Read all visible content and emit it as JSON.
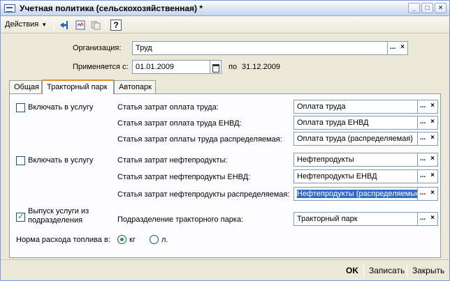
{
  "window": {
    "title": "Учетная политика (сельскохозяйственная) *",
    "minimize": "_",
    "maximize": "□",
    "close": "×"
  },
  "toolbar": {
    "actions_label": "Действия",
    "icons": [
      "back-arrow-icon",
      "structure-icon",
      "copy-icon",
      "help-icon"
    ],
    "help_glyph": "?"
  },
  "header": {
    "organization_label": "Организация:",
    "organization_value": "Труд",
    "applies_label": "Применяется с:",
    "applies_from": "01.01.2009",
    "to_label": "по",
    "applies_to": "31.12.2009",
    "select_glyph": "...",
    "clear_glyph": "×"
  },
  "tabs": [
    {
      "label": "Общая",
      "active": false
    },
    {
      "label": "Тракторный парк",
      "active": true
    },
    {
      "label": "Автопарк",
      "active": false
    }
  ],
  "panel": {
    "group1": {
      "checkbox_label": "Включать в услугу",
      "checked": false,
      "rows": [
        {
          "label": "Статья затрат оплата труда:",
          "value": "Оплата труда"
        },
        {
          "label": "Статья затрат оплата труда ЕНВД:",
          "value": "Оплата труда ЕНВД"
        },
        {
          "label": "Статья затрат оплаты труда распределяемая:",
          "value": "Оплата труда (распределяемая)"
        }
      ]
    },
    "group2": {
      "checkbox_label": "Включать в услугу",
      "checked": false,
      "rows": [
        {
          "label": "Статья затрат нефтепродукты:",
          "value": "Нефтепродукты"
        },
        {
          "label": "Статья затрат нефтепродукты ЕНВД:",
          "value": "Нефтепродукты ЕНВД"
        },
        {
          "label": "Статья затрат нефтепродукты распределяемая:",
          "value": "Нефтепродукты (распределяемые"
        }
      ]
    },
    "group3": {
      "checkbox_label_line1": "Выпуск услуги из",
      "checkbox_label_line2": "подразделения",
      "checked": true,
      "row": {
        "label": "Подразделение тракторного парка:",
        "value": "Тракторный парк"
      }
    },
    "fuel": {
      "label": "Норма расхода топлива в:",
      "options": [
        {
          "label": "кг",
          "selected": true
        },
        {
          "label": "л.",
          "selected": false
        }
      ]
    }
  },
  "footer": {
    "ok_label": "OK",
    "save_label": "Записать",
    "close_label": "Закрыть"
  },
  "colors": {
    "accent_selection": "#316ac5",
    "check_green": "#21a121",
    "field_border": "#7f9db9"
  }
}
